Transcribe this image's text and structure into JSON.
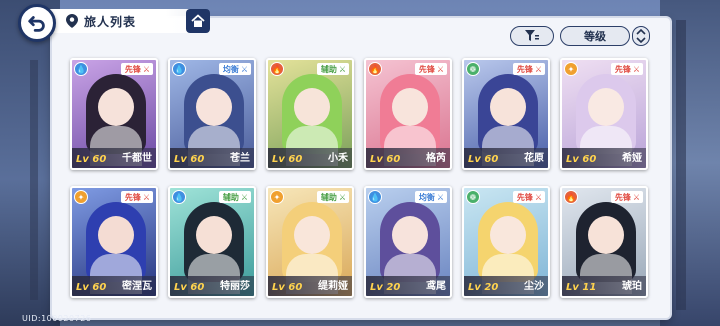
{
  "header": {
    "title": "旅人列表"
  },
  "toolbar": {
    "sort_label": "等级"
  },
  "uid": "UID:100920726",
  "colors": {
    "panel_bg": "#f3f5fa",
    "navy": "#1f3566",
    "tag_red": "#e0483f",
    "tag_blue": "#3f7fd6",
    "tag_green": "#4aa047",
    "level_gold": "#ffd34e"
  },
  "travelers": [
    {
      "name": "千都世",
      "level": "Lv 60",
      "role": "先锋",
      "role_color": "#e0483f",
      "element": "water-icon",
      "element_color": "#3f8fe0",
      "bg": [
        "#c9a3e6",
        "#6b4aa3"
      ],
      "skin": "#f6e2da",
      "hair": "#2b2236"
    },
    {
      "name": "苍兰",
      "level": "Lv 60",
      "role": "均衡",
      "role_color": "#3f7fd6",
      "element": "water-icon",
      "element_color": "#3f8fe0",
      "bg": [
        "#9fb7e6",
        "#4a5c9a"
      ],
      "skin": "#f7e3dc",
      "hair": "#3c4f8f"
    },
    {
      "name": "小禾",
      "level": "Lv 60",
      "role": "辅助",
      "role_color": "#4aa047",
      "element": "fire-icon",
      "element_color": "#e5603b",
      "bg": [
        "#e4e29a",
        "#7aa05a"
      ],
      "skin": "#f7e4d9",
      "hair": "#8fd15a"
    },
    {
      "name": "格芮",
      "level": "Lv 60",
      "role": "先锋",
      "role_color": "#e0483f",
      "element": "fire-icon",
      "element_color": "#e5603b",
      "bg": [
        "#f5c3d2",
        "#d9738f"
      ],
      "skin": "#f8e4dc",
      "hair": "#f07c95"
    },
    {
      "name": "花原",
      "level": "Lv 60",
      "role": "先锋",
      "role_color": "#e0483f",
      "element": "wind-icon",
      "element_color": "#4ab06a",
      "bg": [
        "#b9c8ec",
        "#4a5fa8"
      ],
      "skin": "#f7e3da",
      "hair": "#3a4596"
    },
    {
      "name": "希娅",
      "level": "Lv 60",
      "role": "先锋",
      "role_color": "#e0483f",
      "element": "light-icon",
      "element_color": "#f0a030",
      "bg": [
        "#efdff2",
        "#b9a3d8"
      ],
      "skin": "#f9e9e3",
      "hair": "#dcc9ec"
    },
    {
      "name": "密涅瓦",
      "level": "Lv 60",
      "role": "先锋",
      "role_color": "#e0483f",
      "element": "light-icon",
      "element_color": "#f0a030",
      "bg": [
        "#7f9be3",
        "#27357e"
      ],
      "skin": "#f4dcd3",
      "hair": "#2e3fb0"
    },
    {
      "name": "特丽莎",
      "level": "Lv 60",
      "role": "辅助",
      "role_color": "#4aa047",
      "element": "water-icon",
      "element_color": "#3f8fe0",
      "bg": [
        "#9fe3d8",
        "#3c9a9a"
      ],
      "skin": "#f6e0d6",
      "hair": "#1e2a36"
    },
    {
      "name": "缇莉娅",
      "level": "Lv 60",
      "role": "辅助",
      "role_color": "#4aa047",
      "element": "light-icon",
      "element_color": "#f0a030",
      "bg": [
        "#f7e6b9",
        "#d9a858"
      ],
      "skin": "#f9e6da",
      "hair": "#f4cf7a"
    },
    {
      "name": "鸢尾",
      "level": "Lv 20",
      "role": "均衡",
      "role_color": "#3f7fd6",
      "element": "water-icon",
      "element_color": "#3f8fe0",
      "bg": [
        "#b9cfee",
        "#6a84c0"
      ],
      "skin": "#f7e3dc",
      "hair": "#5e4f9c"
    },
    {
      "name": "尘沙",
      "level": "Lv 20",
      "role": "先锋",
      "role_color": "#e0483f",
      "element": "wind-icon",
      "element_color": "#4ab06a",
      "bg": [
        "#c9e6f2",
        "#7fb5d6"
      ],
      "skin": "#f9e7dc",
      "hair": "#f5d46e"
    },
    {
      "name": "琥珀",
      "level": "Lv 11",
      "role": "先锋",
      "role_color": "#e0483f",
      "element": "fire-icon",
      "element_color": "#e5603b",
      "bg": [
        "#e0e6ee",
        "#9aa8b8"
      ],
      "skin": "#f7e2d8",
      "hair": "#1e2330"
    }
  ]
}
